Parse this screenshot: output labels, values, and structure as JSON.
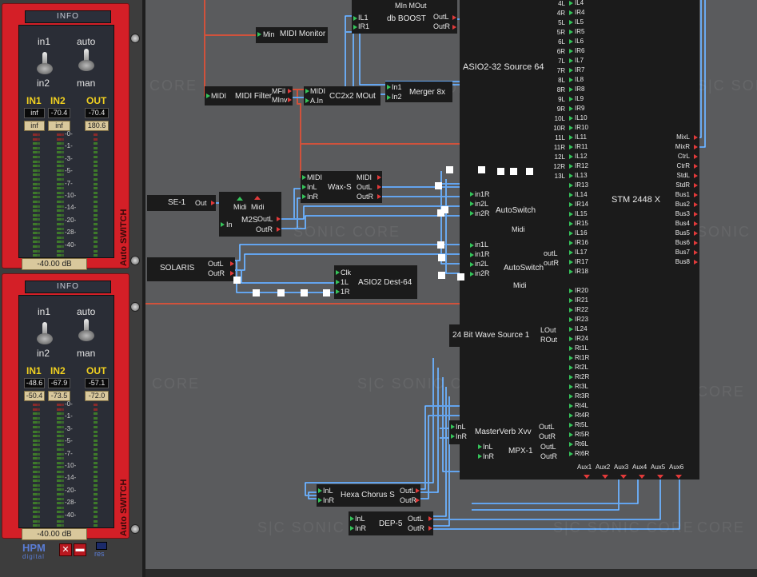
{
  "switches": [
    {
      "header": "INFO",
      "top_labels": [
        "in1",
        "auto"
      ],
      "bottom_labels": [
        "in2",
        "man"
      ],
      "ch_labels": [
        "IN1",
        "IN2",
        "OUT"
      ],
      "row1": [
        "inf",
        "-70.4",
        "-70.4"
      ],
      "row2": [
        "inf",
        "inf",
        "180.6"
      ],
      "ticks": [
        "-0-",
        "-1-",
        "-3-",
        "-5-",
        "-7-",
        "-10-",
        "-14-",
        "-20-",
        "-28-",
        "-40-"
      ],
      "db": "-40.00 dB",
      "side_label": "Auto SWITCH"
    },
    {
      "header": "INFO",
      "top_labels": [
        "in1",
        "auto"
      ],
      "bottom_labels": [
        "in2",
        "man"
      ],
      "ch_labels": [
        "IN1",
        "IN2",
        "OUT"
      ],
      "row1": [
        "-48.6",
        "-67.9",
        "-57.1"
      ],
      "row2": [
        "-50.4",
        "-73.5",
        "-72.0"
      ],
      "ticks": [
        "-0-",
        "-1-",
        "-3-",
        "-5-",
        "-7-",
        "-10-",
        "-14-",
        "-20-",
        "-28-",
        "-40-"
      ],
      "db": "-40.00 dB",
      "side_label": "Auto SWITCH"
    }
  ],
  "brand": {
    "name": "HPM",
    "sub": "digital",
    "res": "res"
  },
  "watermarks": [
    "CORE",
    "SONIC CORE",
    "CORE",
    "S|C SONIC CORE",
    "CORE",
    "S|C SONIC CORE",
    "S|C SONIC CORE",
    "S|C SONIC CORE",
    "CORE",
    "SONIC CORE",
    "CORE"
  ],
  "modules": {
    "midi_monitor": {
      "in": "Min",
      "title": "MIDI Monitor"
    },
    "midi_filter": {
      "in": "MIDI",
      "title": "MIDI Filter",
      "out1": "MFil",
      "out2": "MInv"
    },
    "db_boost": {
      "top": "MIn MOut",
      "in1": "IL1",
      "in2": "IR1",
      "title": "db BOOST",
      "out1": "OutL",
      "out2": "OutR"
    },
    "cc2x2": {
      "in1": "MIDI",
      "in2": "A.In",
      "title": "CC2x2 MOut"
    },
    "merger": {
      "in1": "In1",
      "in2": "In2",
      "title": "Merger 8x"
    },
    "asio_src": {
      "title": "ASIO2-32 Source 64"
    },
    "wax": {
      "in1": "MIDI",
      "in2": "InL",
      "in3": "InR",
      "title": "Wax-S",
      "out1": "MIDI",
      "out2": "OutL",
      "out3": "OutR"
    },
    "se1": {
      "title": "SE-1",
      "out": "Out"
    },
    "m2s": {
      "top1": "Midi",
      "top2": "Midi",
      "in": "In",
      "title": "M2S",
      "out1": "OutL",
      "out2": "OutR"
    },
    "autoswitch1": {
      "in1": "in1R",
      "in2": "in2L",
      "in3": "in2R",
      "title": "AutoSwitch",
      "midi": "Midi"
    },
    "autoswitch2": {
      "in1": "in1L",
      "in2": "in1R",
      "in3": "in2L",
      "in4": "in2R",
      "title": "AutoSwitch",
      "midi": "Midi",
      "outL": "outL",
      "outR": "outR"
    },
    "solaris": {
      "title": "SOLARIS",
      "out1": "OutL",
      "out2": "OutR"
    },
    "asio_dest": {
      "in1": "Clk",
      "in2": "1L",
      "in3": "1R",
      "title": "ASIO2 Dest-64"
    },
    "wave_src": {
      "title": "24 Bit Wave Source 1",
      "out1": "LOut",
      "out2": "ROut"
    },
    "masterverb": {
      "in1": "InL",
      "in2": "InR",
      "title": "MasterVerb Xvv",
      "out1": "OutL",
      "out2": "OutR"
    },
    "mpx1": {
      "in1": "InL",
      "in2": "InR",
      "title": "MPX-1",
      "out1": "OutL",
      "out2": "OutR"
    },
    "hexa": {
      "in1": "InL",
      "in2": "InR",
      "title": "Hexa Chorus S",
      "out1": "OutL",
      "out2": "OutR"
    },
    "dep5": {
      "in1": "InL",
      "in2": "InR",
      "title": "DEP-5",
      "out1": "OutL",
      "out2": "OutR"
    }
  },
  "mixer": {
    "title": "STM 2448 X",
    "left_labels": [
      "4L",
      "4R",
      "5L",
      "5R",
      "6L",
      "6R",
      "7L",
      "7R",
      "8L",
      "8R",
      "9L",
      "9R",
      "10L",
      "10R",
      "11L",
      "11R",
      "12L",
      "12R",
      "13L",
      "13R",
      "outL",
      "outR"
    ],
    "inputs": [
      "IL4",
      "IR4",
      "IL5",
      "IR5",
      "IL6",
      "IR6",
      "IL7",
      "IR7",
      "IL8",
      "IR8",
      "IL9",
      "IR9",
      "IL10",
      "IR10",
      "IL11",
      "IR11",
      "IL12",
      "IR12",
      "IL13",
      "IR13",
      "IL14",
      "IR14",
      "IL15",
      "IR15",
      "IL16",
      "IR16",
      "IL17",
      "IR17",
      "IR18",
      "IR20",
      "IR21",
      "IR22",
      "IR23",
      "IL24",
      "IR24",
      "Rt1L",
      "Rt1R",
      "Rt2L",
      "Rt2R",
      "Rt3L",
      "Rt3R",
      "Rt4L",
      "Rt4R",
      "Rt5L",
      "Rt5R",
      "Rt6L",
      "Rt6R"
    ],
    "outputs": [
      "MixL",
      "MixR",
      "CtrL",
      "CtrR",
      "StdL",
      "StdR",
      "Bus1",
      "Bus2",
      "Bus3",
      "Bus4",
      "Bus5",
      "Bus6",
      "Bus7",
      "Bus8"
    ],
    "aux": [
      "Aux1",
      "Aux2",
      "Aux3",
      "Aux4",
      "Aux5",
      "Aux6"
    ]
  },
  "colors": {
    "wire_blue": "#3f8fe8",
    "wire_red": "#d0523c",
    "panel_red": "#d41f27",
    "module_bg": "#1b1b1b",
    "canvas": "#5a5b5d"
  }
}
